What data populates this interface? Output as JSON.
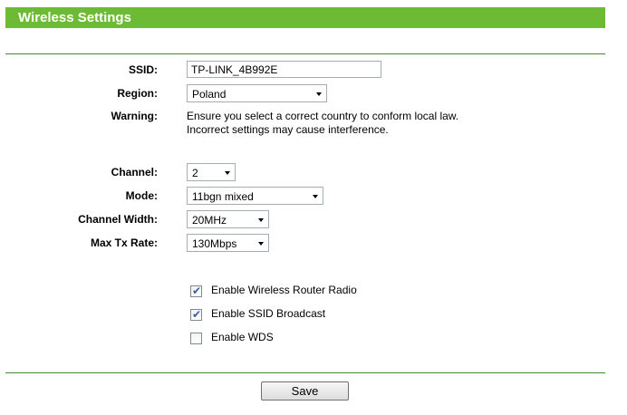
{
  "header": {
    "title": "Wireless Settings"
  },
  "form": {
    "ssid": {
      "label": "SSID:",
      "value": "TP-LINK_4B992E"
    },
    "region": {
      "label": "Region:",
      "value": "Poland"
    },
    "warning": {
      "label": "Warning:",
      "line1": "Ensure you select a correct country to conform local law.",
      "line2": "Incorrect settings may cause interference."
    },
    "channel": {
      "label": "Channel:",
      "value": "2"
    },
    "mode": {
      "label": "Mode:",
      "value": "11bgn mixed"
    },
    "channel_width": {
      "label": "Channel Width:",
      "value": "20MHz"
    },
    "max_tx_rate": {
      "label": "Max Tx Rate:",
      "value": "130Mbps"
    }
  },
  "options": [
    {
      "label": "Enable Wireless Router Radio",
      "checked": true
    },
    {
      "label": "Enable SSID Broadcast",
      "checked": true
    },
    {
      "label": "Enable WDS",
      "checked": false
    }
  ],
  "checkmark_glyph": "✔",
  "actions": {
    "save_label": "Save"
  }
}
